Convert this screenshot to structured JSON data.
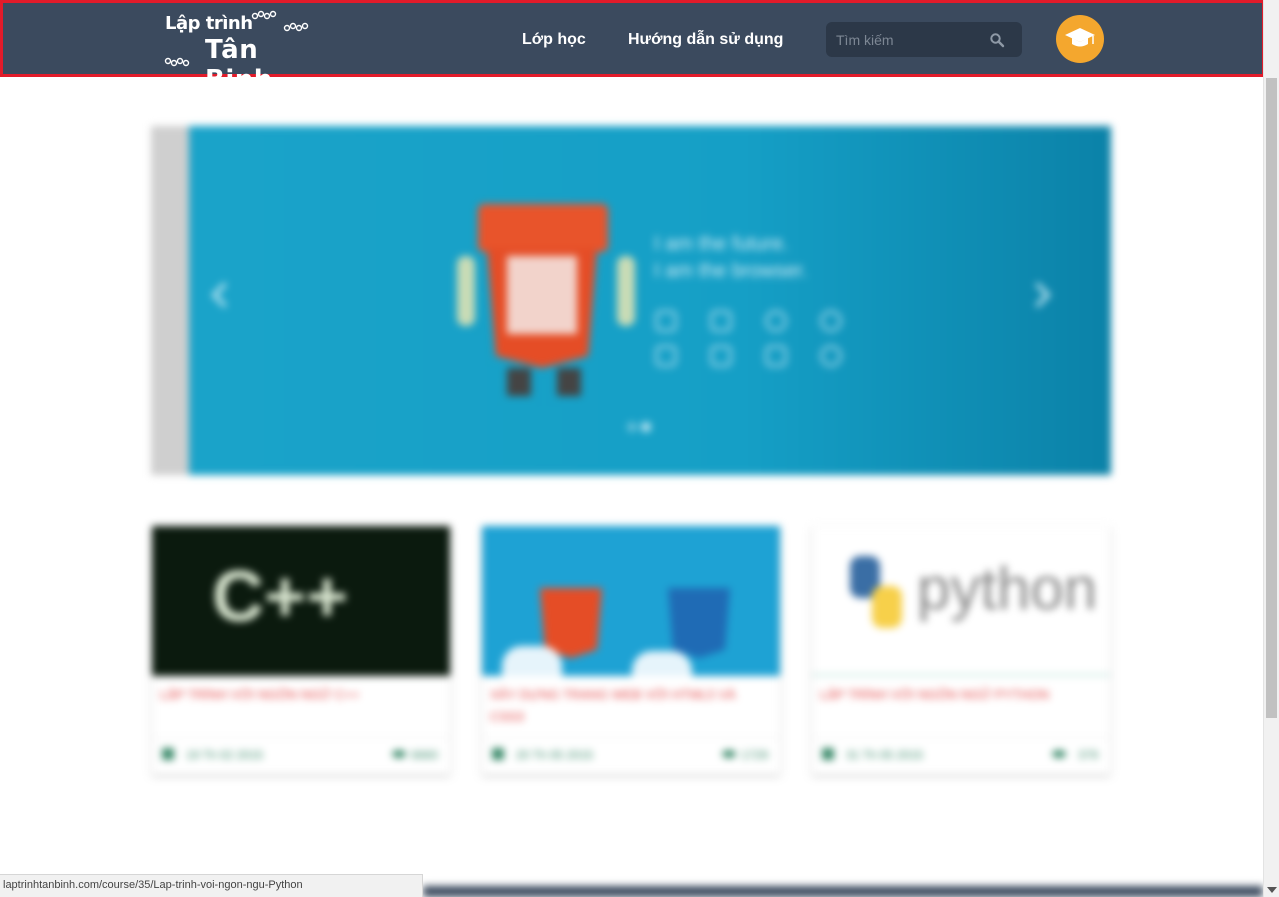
{
  "header": {
    "logo_line1": "Lập trình",
    "logo_line2": "Tân Binh",
    "nav": [
      {
        "label": "Lớp học"
      },
      {
        "label": "Hướng dẫn sử dụng"
      }
    ],
    "search": {
      "placeholder": "Tìm kiếm",
      "value": ""
    },
    "avatar_icon": "graduation-cap-icon"
  },
  "colors": {
    "navbar_bg": "#3b4a5e",
    "highlight_border": "#e21b2a",
    "avatar": "#f4a72e",
    "slider_bg": "#159fc6",
    "card_title": "#e34545",
    "card_meta": "#3a8a6a"
  },
  "slider": {
    "tagline_line1": "I am the future.",
    "tagline_line2": "I am the browser."
  },
  "courses": [
    {
      "title": "LẬP TRÌNH VỚI NGÔN NGỮ C++",
      "date": "19 Th 02 2015",
      "views": "6660",
      "thumb_text": "C++"
    },
    {
      "title": "XÂY DỰNG TRANG WEB VỚI HTML5 VÀ CSS3",
      "date": "20 Th 05 2015",
      "views": "1729",
      "thumb_text": ""
    },
    {
      "title": "LẬP TRÌNH VỚI NGÔN NGỮ PYTHON",
      "date": "31 Th 05 2015",
      "views": "379",
      "thumb_text": "python"
    }
  ],
  "status_bar": {
    "url": "laptrinhtanbinh.com/course/35/Lap-trinh-voi-ngon-ngu-Python"
  }
}
